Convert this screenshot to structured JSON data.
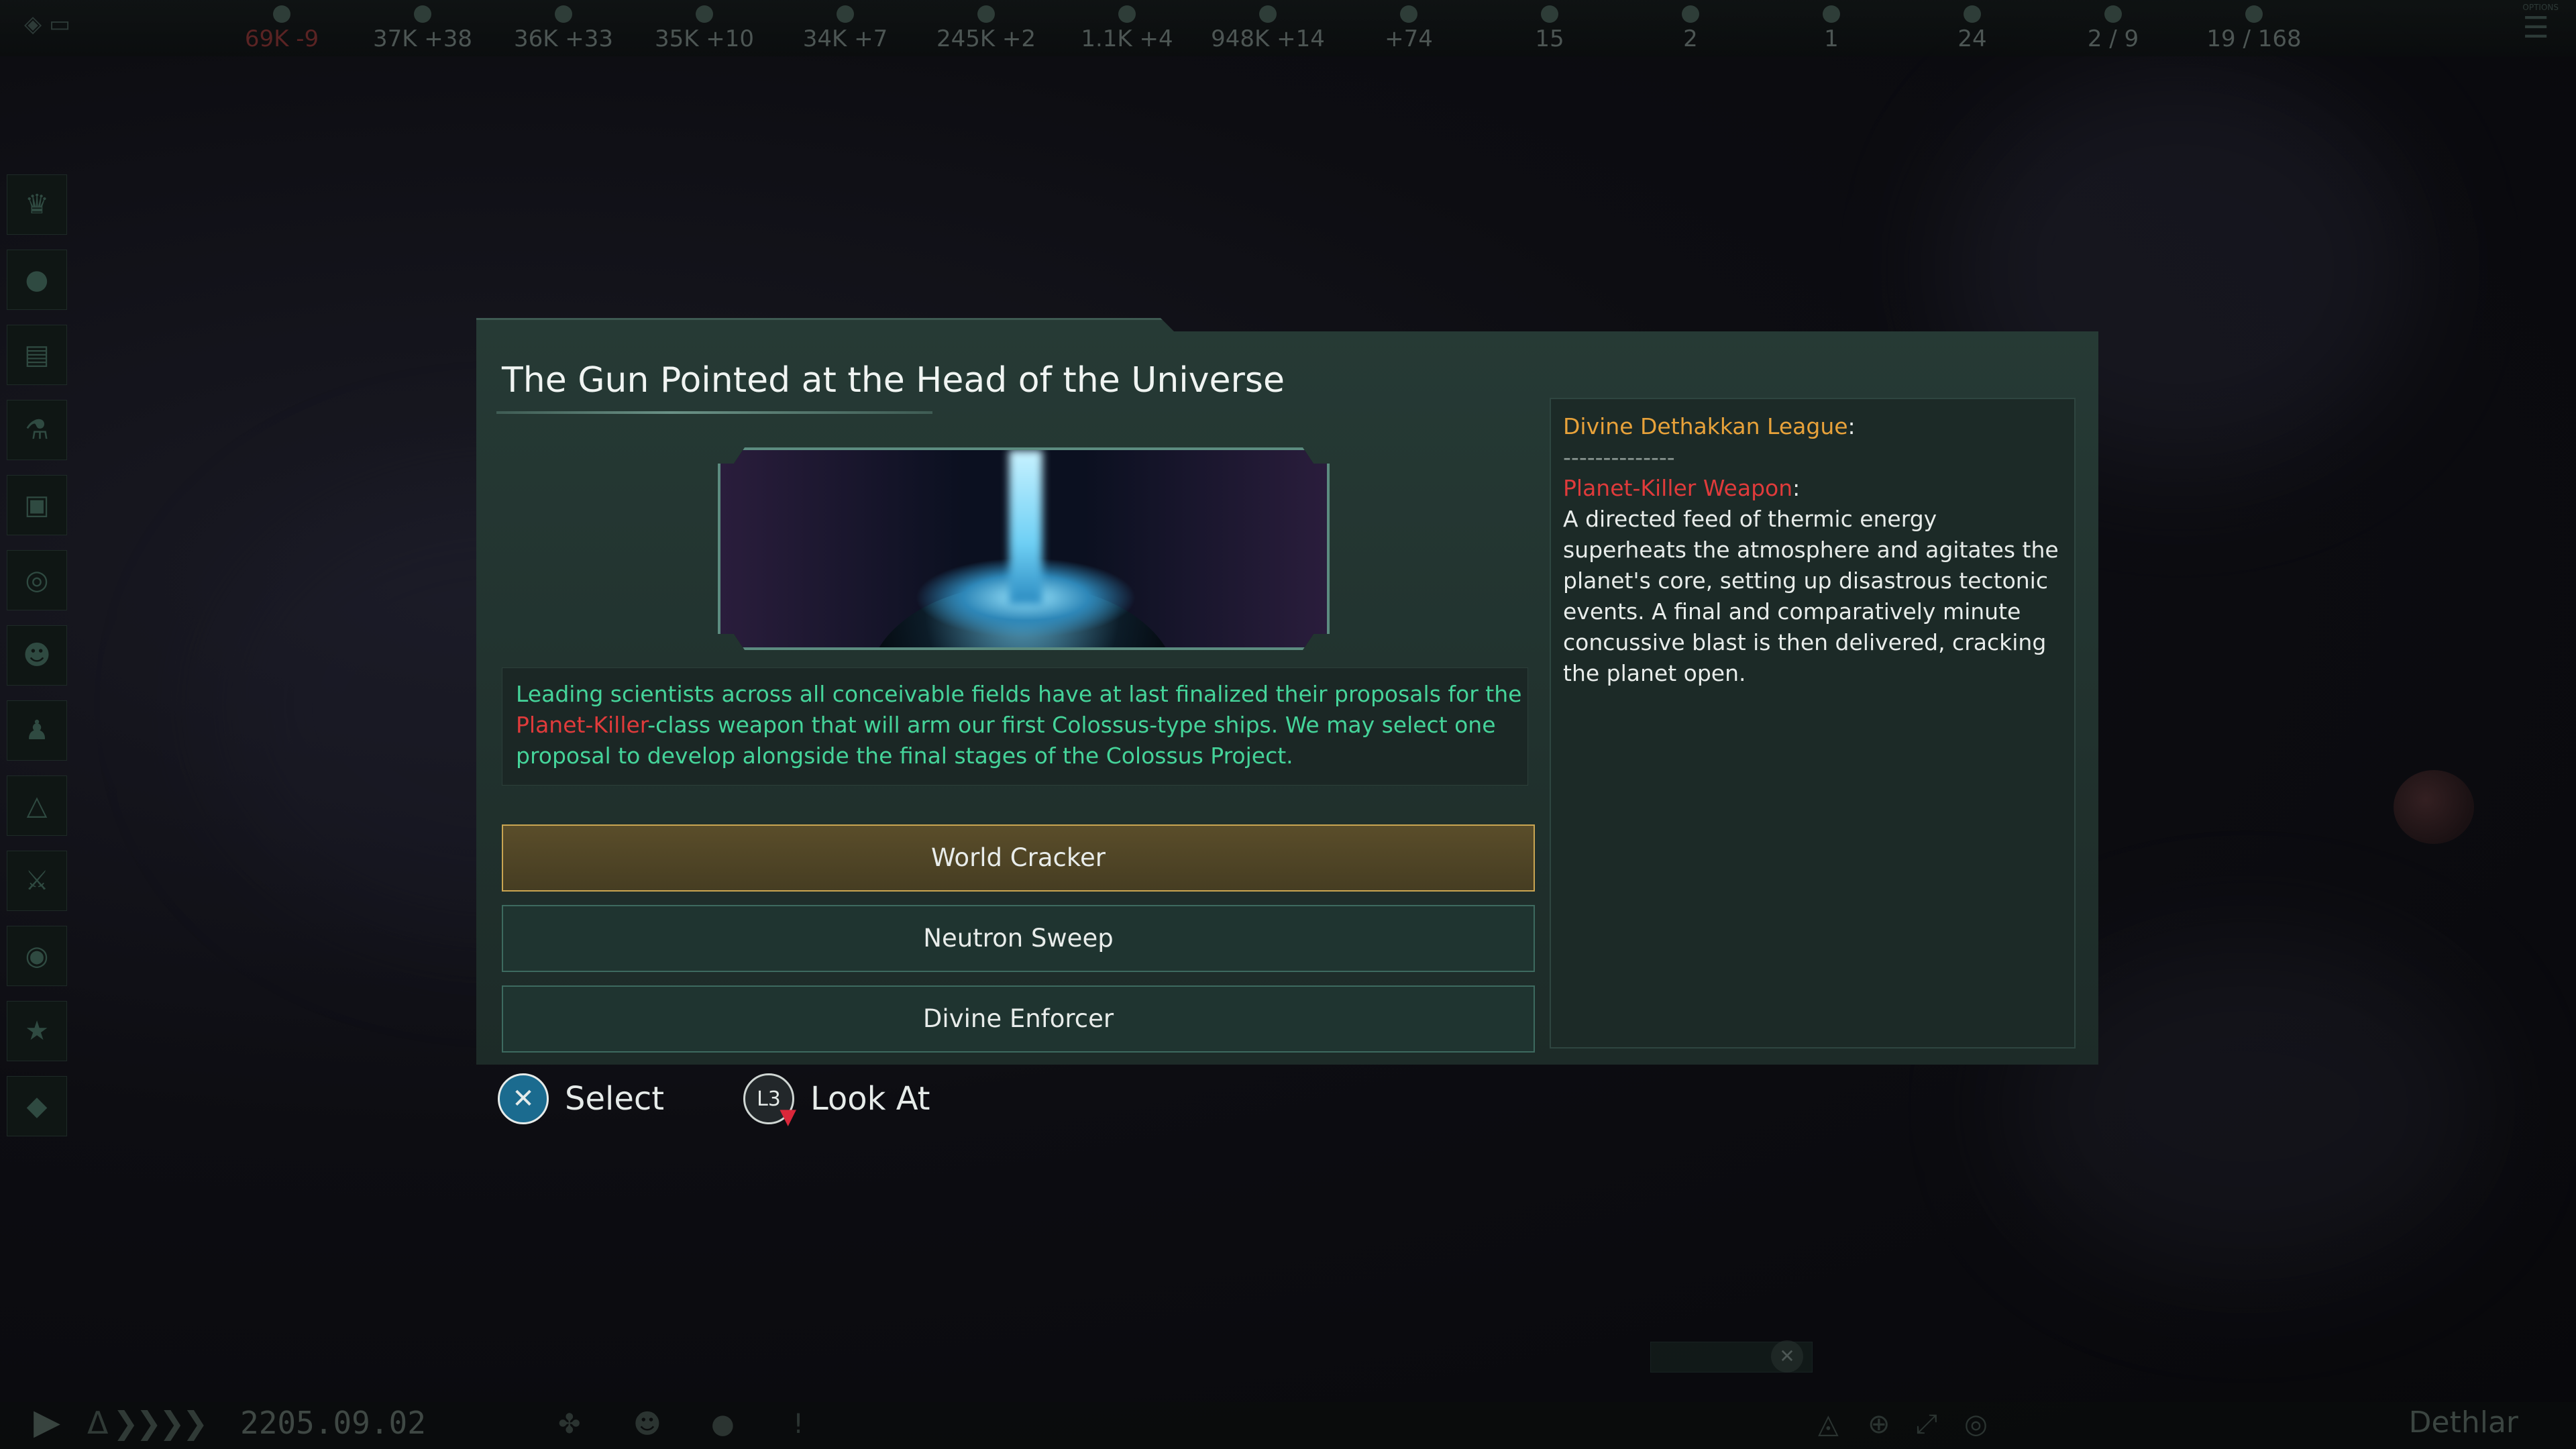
{
  "top_bar": {
    "resources": [
      {
        "value": "69K -9",
        "negative": true,
        "icon": "energy-icon"
      },
      {
        "value": "37K +38",
        "icon": "minerals-icon"
      },
      {
        "value": "36K +33",
        "icon": "food-icon"
      },
      {
        "value": "35K +10",
        "icon": "consumer-goods-icon"
      },
      {
        "value": "34K +7",
        "icon": "alloys-icon"
      },
      {
        "value": "245K +2",
        "icon": "influence-icon"
      },
      {
        "value": "1.1K +4",
        "icon": "unity-icon"
      },
      {
        "value": "948K +14",
        "icon": "research-icon"
      },
      {
        "value": "+74",
        "icon": "amenities-icon"
      },
      {
        "value": "15",
        "icon": "stability-icon"
      },
      {
        "value": "2",
        "icon": "trade-icon"
      },
      {
        "value": "1",
        "icon": "envoy-icon"
      },
      {
        "value": "24",
        "icon": "pops-icon"
      },
      {
        "value": "2 / 9",
        "icon": "capacity-icon"
      },
      {
        "value": "19 / 168",
        "icon": "fleet-icon"
      }
    ],
    "options_label": "OPTIONS"
  },
  "bottom_bar": {
    "date": "2205.09.02",
    "empire": "Dethlar"
  },
  "dialog": {
    "title": "The Gun Pointed at the Head of the Universe",
    "description_parts": [
      "Leading scientists across all conceivable fields have at last finalized their proposals for the ",
      "Planet-Killer",
      "-class weapon that will arm our first Colossus-type ships. We may select one proposal to develop alongside the final stages of the Colossus Project."
    ],
    "options": [
      "World Cracker",
      "Neutron Sweep",
      "Divine Enforcer"
    ],
    "info": {
      "faction": "Divine Dethakkan League",
      "colon": ":",
      "divider": "--------------",
      "weapon": "Planet-Killer Weapon",
      "weapon_text": "A directed feed of thermic energy superheats the atmosphere and agitates the planet's core, setting up disastrous tectonic events. A final and comparatively minute concussive blast is then delivered, cracking the planet open."
    }
  },
  "hints": {
    "select": "Select",
    "look_at": "Look At",
    "l3": "L3"
  },
  "colors": {
    "accent_green": "#45d49a",
    "warning_red": "#e03b3b",
    "faction_orange": "#e8a23a",
    "selected_gold": "#c9a552"
  }
}
